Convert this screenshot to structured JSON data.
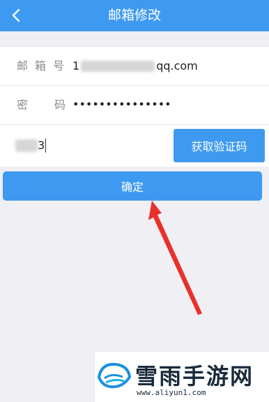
{
  "header": {
    "title": "邮箱修改",
    "back_icon": "chevron-left-icon"
  },
  "form": {
    "email_label": "邮箱号",
    "email_prefix": "1",
    "email_suffix": "qq.com",
    "password_label": "密码",
    "password_value": "•••••••••••••••",
    "code_suffix": "3",
    "get_code_label": "获取验证码"
  },
  "confirm_label": "确定",
  "watermark": {
    "text": "雪雨手游网",
    "url": "www.aliyun1.com"
  },
  "colors": {
    "accent": "#3e9af0",
    "arrow": "#e8312a"
  }
}
